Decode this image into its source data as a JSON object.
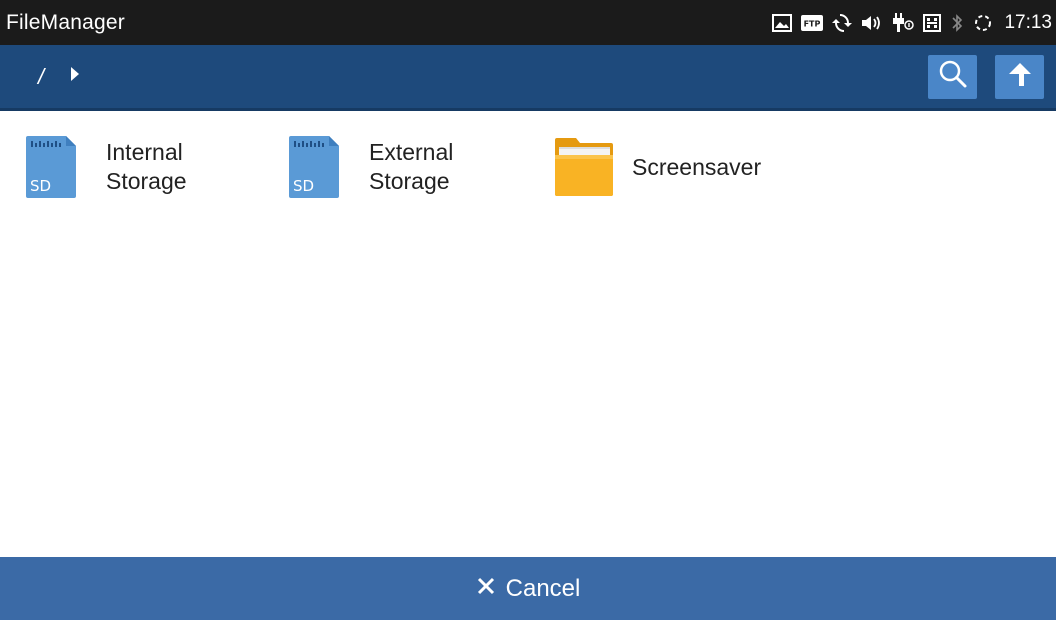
{
  "status_bar": {
    "app_title": "FileManager",
    "clock": "17:13",
    "icons": [
      "image-icon",
      "ftp-icon",
      "sync-icon",
      "volume-icon",
      "usb-icon",
      "keyboard-icon",
      "bluetooth-icon",
      "loading-icon"
    ],
    "ftp_label": "FTP"
  },
  "toolbar": {
    "breadcrumb_root": "/",
    "buttons": [
      "search-icon",
      "up-arrow-icon"
    ],
    "accent_color": "#4a86c8",
    "background_color": "#1e4a7c"
  },
  "files": [
    {
      "line1": "Internal",
      "line2": "Storage",
      "icon": "sd-card-icon",
      "badge": "SD"
    },
    {
      "line1": "External",
      "line2": "Storage",
      "icon": "sd-card-icon",
      "badge": "SD"
    },
    {
      "label": "Screensaver",
      "icon": "folder-icon"
    }
  ],
  "bottom_bar": {
    "cancel_label": "Cancel",
    "background_color": "#3b6aa6"
  }
}
